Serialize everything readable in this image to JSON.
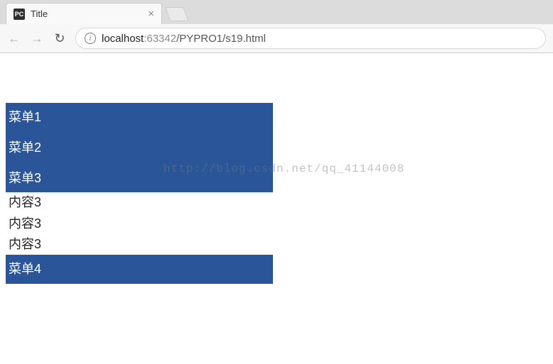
{
  "browser": {
    "tab": {
      "favicon": "PC",
      "title": "Title",
      "close": "×"
    },
    "url": {
      "host": "localhost",
      "port": ":63342",
      "path": "/PYPRO1/s19.html"
    }
  },
  "menu": {
    "items": [
      {
        "label": "菜单1"
      },
      {
        "label": "菜单2"
      },
      {
        "label": "菜单3"
      },
      {
        "label": "菜单4"
      }
    ]
  },
  "content": {
    "items": [
      {
        "text": "内容3"
      },
      {
        "text": "内容3"
      },
      {
        "text": "内容3"
      }
    ]
  },
  "watermark": "http://blog.csdn.net/qq_41144008"
}
